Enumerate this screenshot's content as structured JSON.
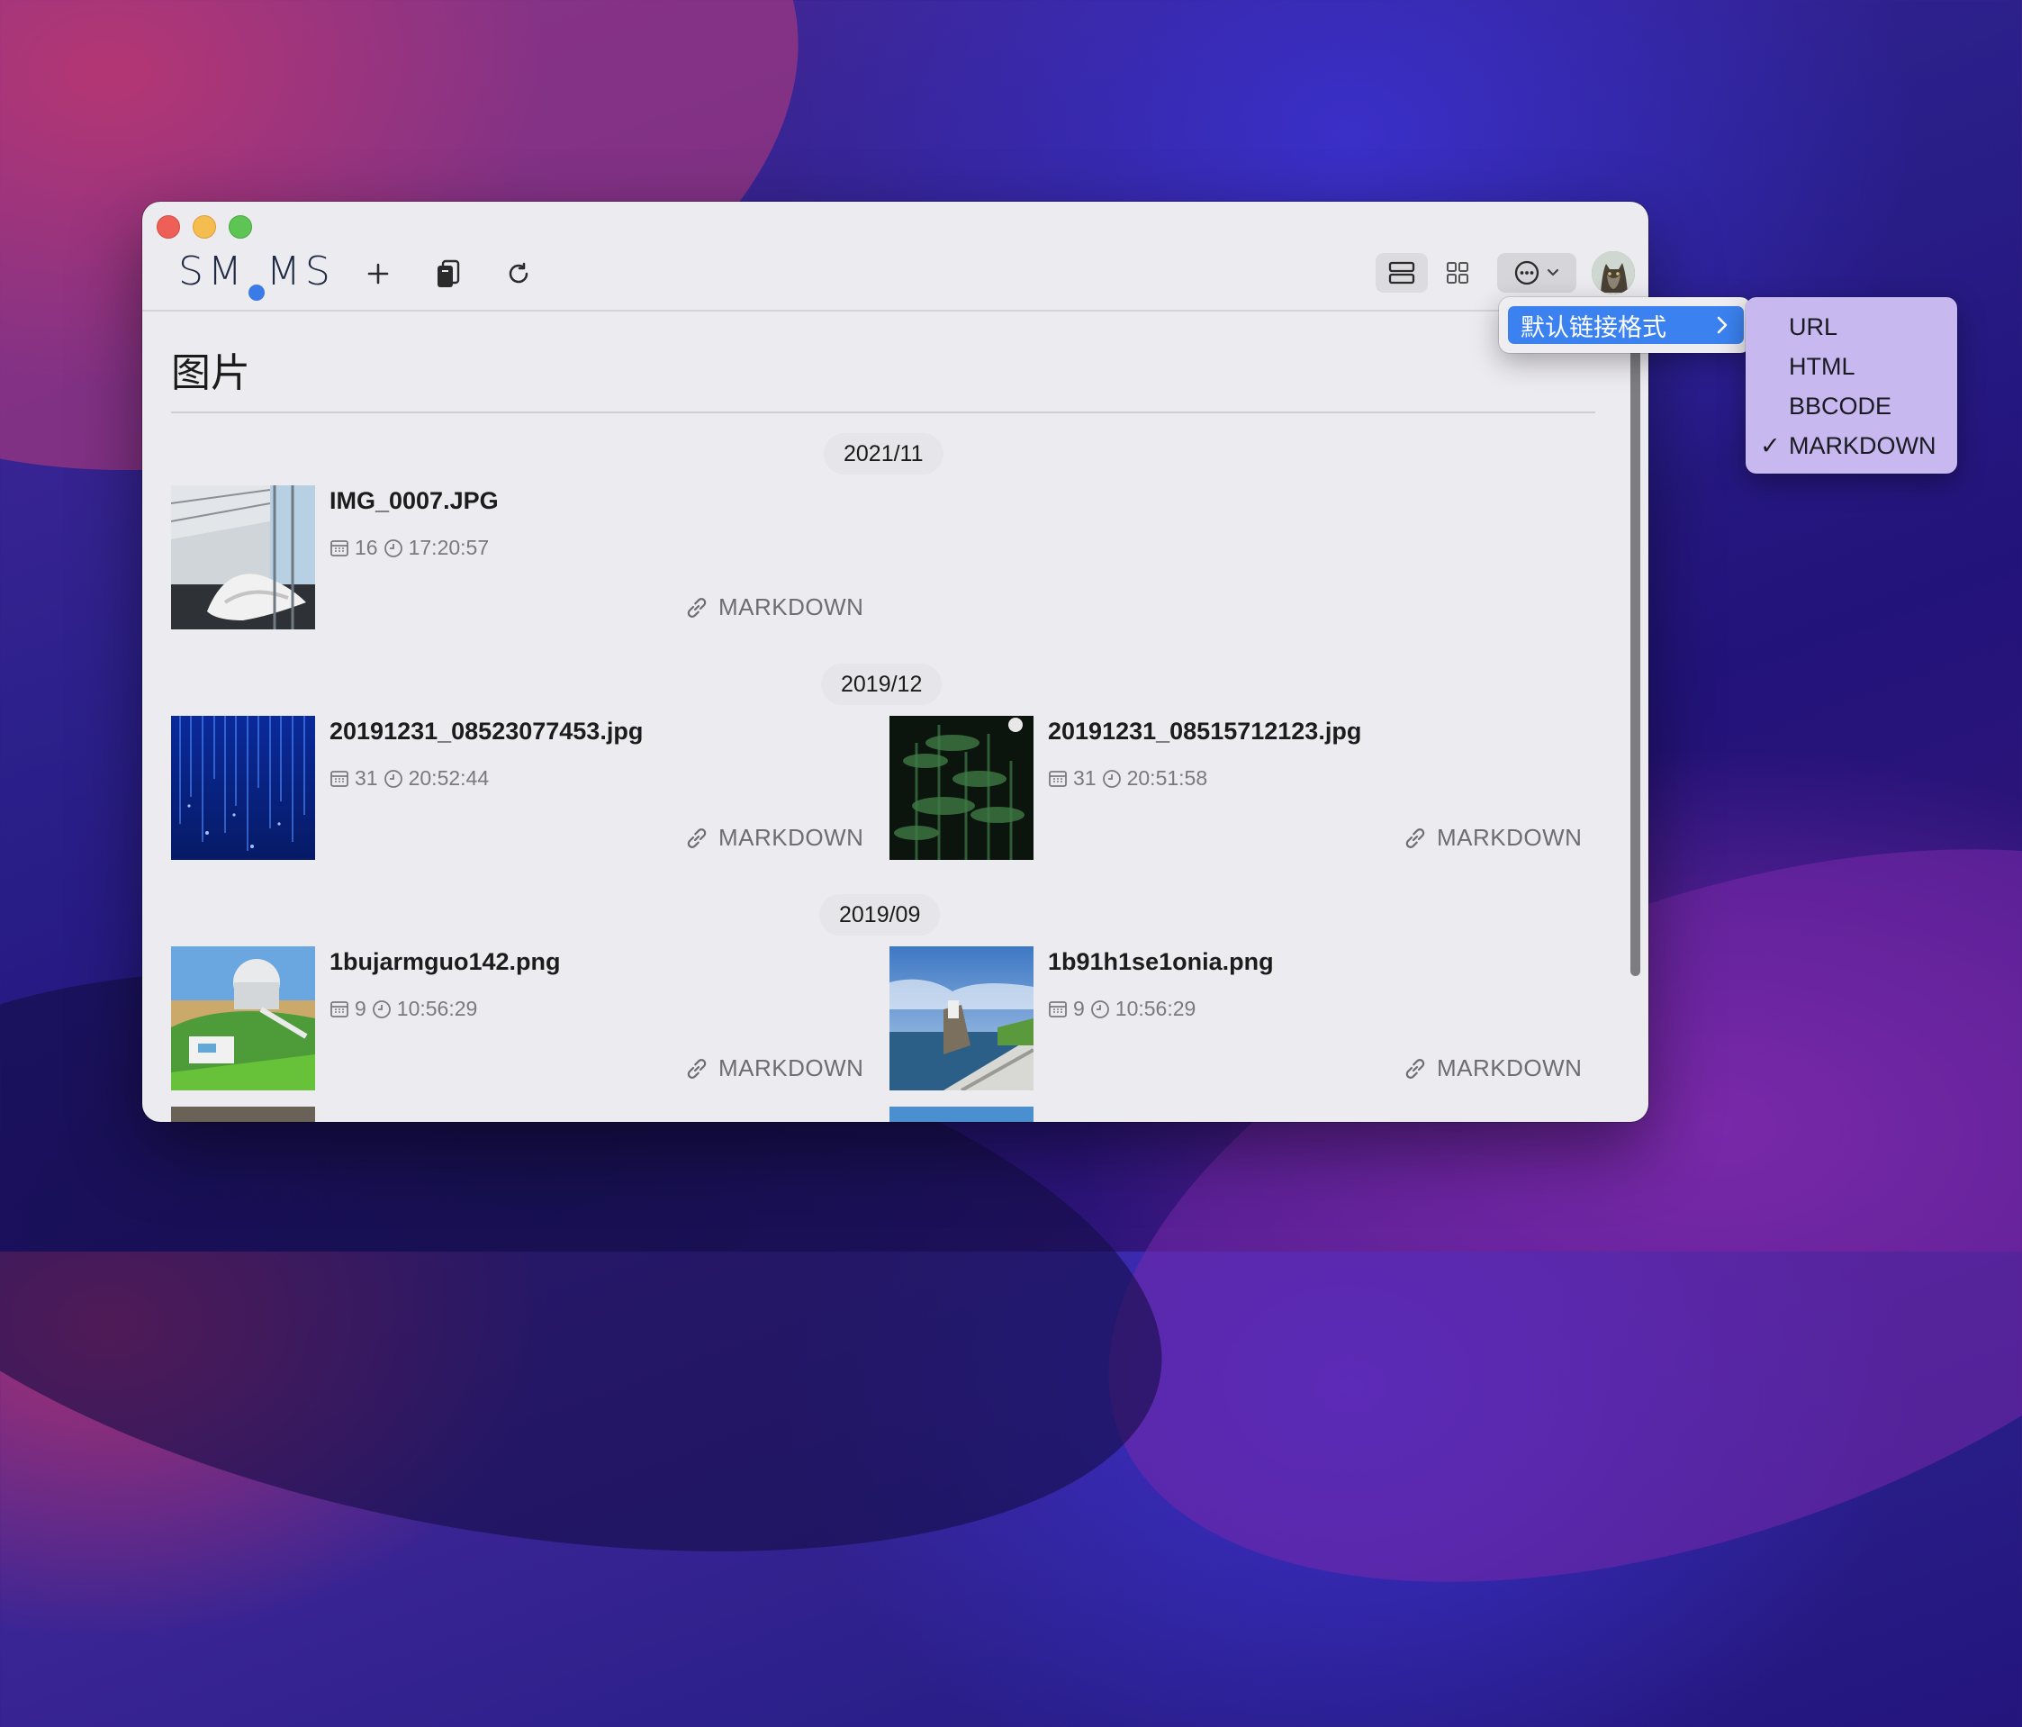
{
  "app": {
    "logo_left": "SM",
    "logo_right": "MS"
  },
  "toolbar": {
    "add_icon": "plus-icon",
    "clipboard_icon": "clipboard-icon",
    "refresh_icon": "refresh-icon",
    "list_view_icon": "list-view-icon",
    "grid_view_icon": "grid-view-icon",
    "more_icon": "ellipsis-circle-icon"
  },
  "page": {
    "title": "图片"
  },
  "groups": [
    {
      "date": "2021/11",
      "items": [
        {
          "name": "IMG_0007.JPG",
          "day": "16",
          "time": "17:20:57",
          "link": "MARKDOWN"
        }
      ]
    },
    {
      "date": "2019/12",
      "items": [
        {
          "name": "20191231_08523077453.jpg",
          "day": "31",
          "time": "20:52:44",
          "link": "MARKDOWN"
        },
        {
          "name": "20191231_08515712123.jpg",
          "day": "31",
          "time": "20:51:58",
          "link": "MARKDOWN"
        }
      ]
    },
    {
      "date": "2019/09",
      "items": [
        {
          "name": "1bujarmguo142.png",
          "day": "9",
          "time": "10:56:29",
          "link": "MARKDOWN"
        },
        {
          "name": "1b91h1se1onia.png",
          "day": "9",
          "time": "10:56:29",
          "link": "MARKDOWN"
        }
      ]
    }
  ],
  "menu": {
    "item": "默认链接格式",
    "submenu": [
      "URL",
      "HTML",
      "BBCODE",
      "MARKDOWN"
    ],
    "checked": "MARKDOWN",
    "checkmark": "✓"
  },
  "colors": {
    "accent": "#3b82f0",
    "submenu_bg": "#c7b8ef"
  }
}
